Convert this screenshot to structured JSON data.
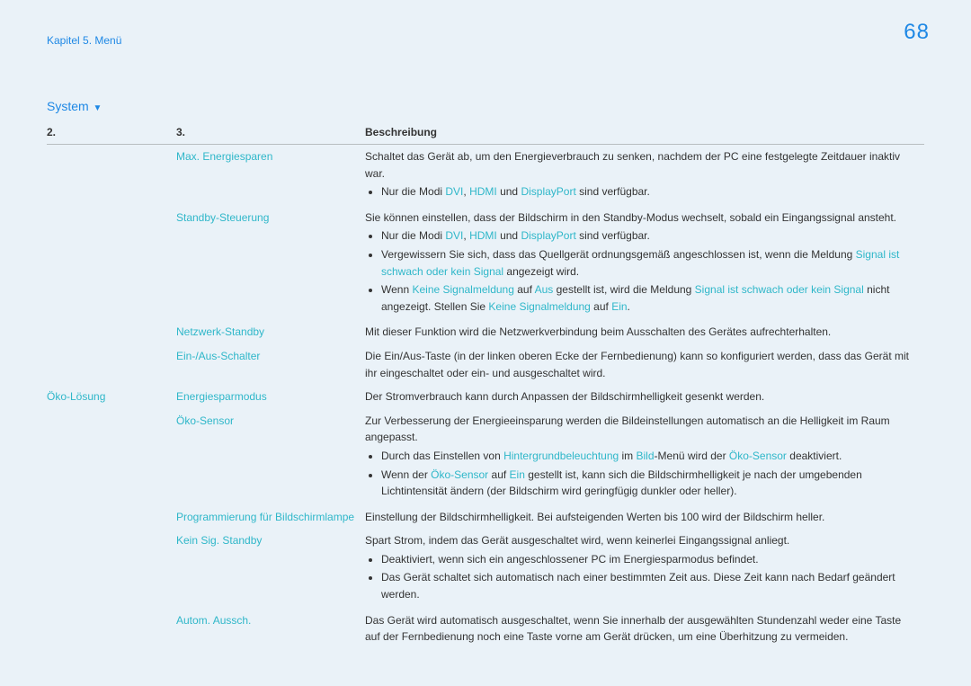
{
  "breadcrumb": "Kapitel 5. Menü",
  "pageNumber": "68",
  "sectionTitle": "System",
  "headers": {
    "c1": "2.",
    "c2": "3.",
    "c3": "Beschreibung"
  },
  "labels": {
    "oeko": "Öko-Lösung",
    "maxEnergie": "Max. Energiesparen",
    "standbySteuerung": "Standby-Steuerung",
    "netzwerkStandby": "Netzwerk-Standby",
    "einAus": "Ein-/Aus-Schalter",
    "energiesparmodus": "Energiesparmodus",
    "oekoSensor": "Öko-Sensor",
    "progBildschirm": "Programmierung für Bildschirmlampe",
    "keinSigStandby": "Kein Sig. Standby",
    "automAussch": "Autom. Aussch."
  },
  "desc": {
    "maxEnergie": "Schaltet das Gerät ab, um den Energieverbrauch zu senken, nachdem der PC eine festgelegte Zeitdauer inaktiv war.",
    "standbySteuerung": "Sie können einstellen, dass der Bildschirm in den Standby-Modus wechselt, sobald ein Eingangssignal ansteht.",
    "netzwerkStandby": "Mit dieser Funktion wird die Netzwerkverbindung beim Ausschalten des Gerätes aufrechterhalten.",
    "einAus": "Die Ein/Aus-Taste (in der linken oberen Ecke der Fernbedienung) kann so konfiguriert werden, dass das Gerät mit ihr eingeschaltet oder ein- und ausgeschaltet wird.",
    "energiesparmodus": "Der Stromverbrauch kann durch Anpassen der Bildschirmhelligkeit gesenkt werden.",
    "oekoSensor": "Zur Verbesserung der Energieeinsparung werden die Bildeinstellungen automatisch an die Helligkeit im Raum angepasst.",
    "progBildschirm": "Einstellung der Bildschirmhelligkeit. Bei aufsteigenden Werten bis 100 wird der Bildschirm heller.",
    "keinSigStandby": "Spart Strom, indem das Gerät ausgeschaltet wird, wenn keinerlei Eingangssignal anliegt.",
    "automAussch": "Das Gerät wird automatisch ausgeschaltet, wenn Sie innerhalb der ausgewählten Stundenzahl weder eine Taste auf der Fernbedienung noch eine Taste vorne am Gerät drücken, um eine Überhitzung zu vermeiden."
  },
  "notes": {
    "nurModi_pre": "Nur die Modi ",
    "dvi": "DVI",
    "c": ", ",
    "hdmi": "HDMI",
    "und": " und ",
    "dp": "DisplayPort",
    "nurModi_post": " sind verfügbar.",
    "standby_b2a": "Vergewissern Sie sich, dass das Quellgerät ordnungsgemäß angeschlossen ist, wenn die Meldung ",
    "signalSchwach": "Signal ist schwach oder kein Signal",
    "standby_b2b": " angezeigt wird.",
    "standby_b3a": "Wenn ",
    "keineSignalmeldung": "Keine Signalmeldung",
    "auf": " auf ",
    "aus": "Aus",
    "standby_b3b": " gestellt ist, wird die Meldung ",
    "standby_b3c": " nicht angezeigt. Stellen Sie ",
    "ein": "Ein",
    "punkt": ".",
    "oeko_b1a": "Durch das Einstellen von ",
    "hgBeleucht": "Hintergrundbeleuchtung",
    "im": " im ",
    "bild": "Bild",
    "oeko_b1b": "-Menü wird der ",
    "oekoSensor": "Öko-Sensor",
    "deaktiviert": " deaktiviert.",
    "oeko_b2a": "Wenn der ",
    "oeko_b2b": " gestellt ist, kann sich die Bildschirmhelligkeit je nach der umgebenden Lichtintensität ändern (der Bildschirm wird geringfügig dunkler oder heller).",
    "keinSig_b1": "Deaktiviert, wenn sich ein angeschlossener PC im Energiesparmodus befindet.",
    "keinSig_b2": "Das Gerät schaltet sich automatisch nach einer bestimmten Zeit aus. Diese Zeit kann nach Bedarf geändert werden."
  }
}
